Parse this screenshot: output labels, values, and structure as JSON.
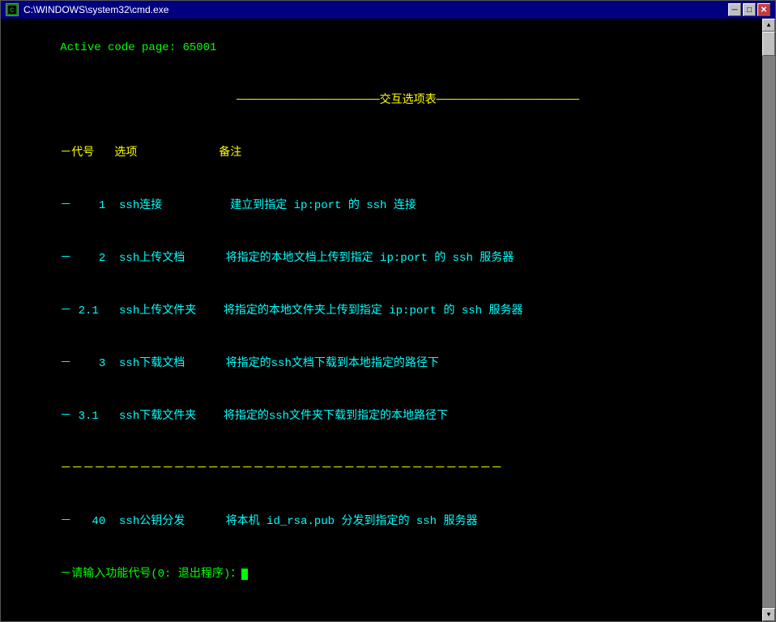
{
  "window": {
    "title": "C:\\WINDOWS\\system32\\cmd.exe",
    "icon_label": "C",
    "btn_minimize": "─",
    "btn_maximize": "□",
    "btn_close": "✕"
  },
  "console": {
    "active_code": "Active code page: 65001",
    "menu_title": "─────────────────────交互选项表─────────────────────",
    "col_headers": "－代号   选项            备注",
    "rows": [
      {
        "code": "－    1",
        "option": "  ssh连接          ",
        "desc": "建立到指定 ip:port 的 ssh 连接"
      },
      {
        "code": "－    2",
        "option": "  ssh上传文档       ",
        "desc": "将指定的本地文档上传到指定 ip:port 的 ssh 服务器"
      },
      {
        "code": "－ 2.1",
        "option": "  ssh上传文件夹     ",
        "desc": "将指定的本地文件夹上传到指定 ip:port 的 ssh 服务器"
      },
      {
        "code": "－    3",
        "option": "  ssh下载文档       ",
        "desc": "将指定的ssh文档下载到本地指定的路径下"
      },
      {
        "code": "－ 3.1",
        "option": "  ssh下载文件夹     ",
        "desc": "将指定的ssh文件夹下载到指定的本地路径下"
      }
    ],
    "separator": "－－－－－－－－－－－－－－－－－－－－－－－－－－－－－－－－－－－－－－－",
    "row_40": {
      "code": "－   40",
      "option": "  ssh公钥分发       ",
      "desc": "将本机 id_rsa.pub 分发到指定的 ssh 服务器"
    },
    "input_prompt": "－请输入功能代号(0: 退出程序)："
  }
}
